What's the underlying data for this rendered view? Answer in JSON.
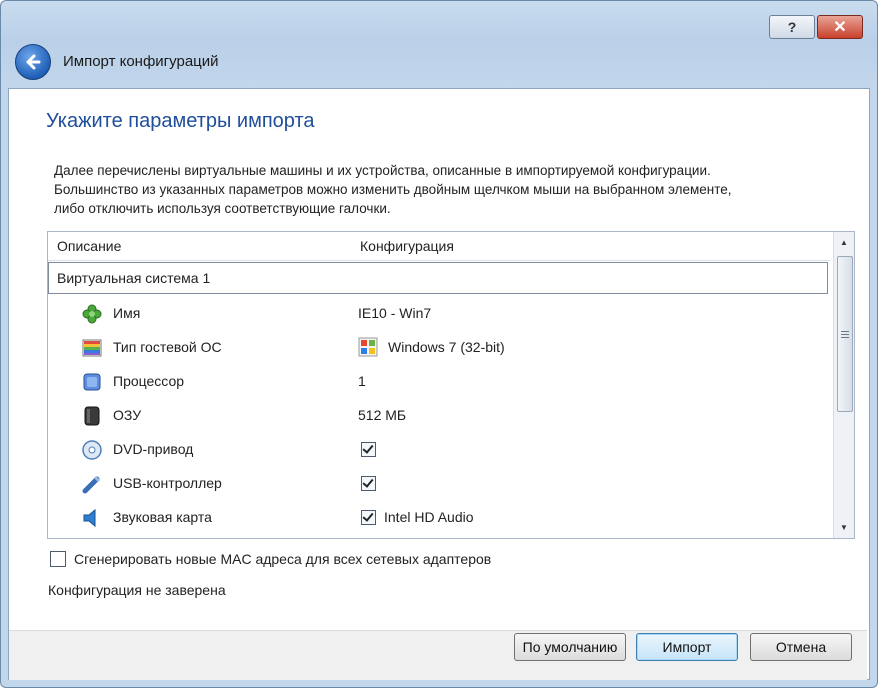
{
  "window": {
    "title": "Импорт конфигураций",
    "help_label": "?",
    "close_label": "✕"
  },
  "page": {
    "heading": "Укажите параметры импорта",
    "description": [
      "Далее перечислены виртуальные машины и их устройства, описанные в импортируемой конфигурации.",
      "Большинство из указанных параметров можно изменить двойным щелчком мыши на выбранном элементе,",
      "либо отключить используя соответствующие галочки."
    ]
  },
  "table": {
    "columns": [
      "Описание",
      "Конфигурация"
    ],
    "group": "Виртуальная система 1",
    "rows": [
      {
        "label": "Имя",
        "value": "IE10 - Win7",
        "icon": "name-icon",
        "type": "text"
      },
      {
        "label": "Тип гостевой ОС",
        "value": "Windows 7 (32-bit)",
        "icon": "os-type-icon",
        "type": "os"
      },
      {
        "label": "Процессор",
        "value": "1",
        "icon": "cpu-icon",
        "type": "text"
      },
      {
        "label": "ОЗУ",
        "value": "512 МБ",
        "icon": "ram-icon",
        "type": "text"
      },
      {
        "label": "DVD-привод",
        "value": "",
        "icon": "dvd-icon",
        "type": "check",
        "checked": true
      },
      {
        "label": "USB-контроллер",
        "value": "",
        "icon": "usb-icon",
        "type": "check",
        "checked": true
      },
      {
        "label": "Звуковая карта",
        "value": "Intel HD Audio",
        "icon": "sound-card-icon",
        "type": "check",
        "checked": true
      }
    ]
  },
  "options": {
    "mac_label": "Сгенерировать новые MAC адреса для всех сетевых адаптеров",
    "mac_checked": false
  },
  "status": "Конфигурация не заверена",
  "buttons": {
    "defaults": "По умолчанию",
    "import": "Импорт",
    "cancel": "Отмена"
  }
}
